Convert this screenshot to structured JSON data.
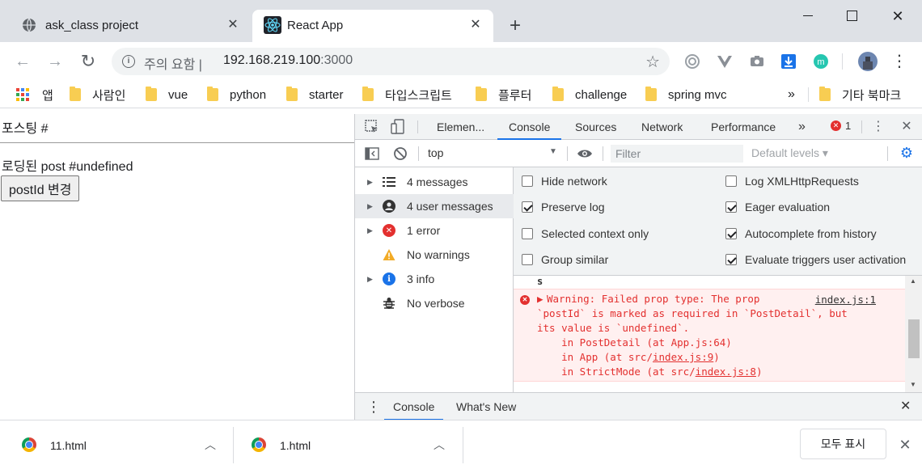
{
  "tabs": [
    {
      "title": "ask_class project",
      "close": "✕"
    },
    {
      "title": "React App",
      "close": "✕"
    }
  ],
  "new_tab": "+",
  "window": {
    "close": "✕"
  },
  "toolbar": {
    "back": "←",
    "forward": "→",
    "reload": "↻",
    "security_label": "주의 요함",
    "url_host": "192.168.219.100",
    "url_port": ":3000",
    "star": "☆",
    "menu": "⋮"
  },
  "bookmarks": {
    "apps": "앱",
    "items": [
      "사람인",
      "vue",
      "python",
      "starter",
      "타입스크립트",
      "플루터",
      "challenge",
      "spring mvc"
    ],
    "more": "»",
    "other": "기타 북마크",
    "apps_colors": [
      "#ea4335",
      "#4285f4",
      "#fbbc05",
      "#34a853",
      "#ea4335",
      "#4285f4",
      "#fbbc05",
      "#34a853",
      "#ea4335"
    ]
  },
  "page": {
    "heading": "포스팅 #",
    "loaded_text": "로딩된 post #undefined",
    "button_label": "postId 변경"
  },
  "devtools": {
    "tabs": [
      "Elemen...",
      "Console",
      "Sources",
      "Network",
      "Performance"
    ],
    "more_tabs": "»",
    "error_count": "1",
    "context": "top",
    "filter_placeholder": "Filter",
    "levels": "Default levels ▾",
    "sidebar": [
      {
        "label": "4 messages",
        "icon": "list-icon"
      },
      {
        "label": "4 user messages",
        "icon": "user-icon"
      },
      {
        "label": "1 error",
        "icon": "error-icon"
      },
      {
        "label": "No warnings",
        "icon": "warning-icon"
      },
      {
        "label": "3 info",
        "icon": "info-icon"
      },
      {
        "label": "No verbose",
        "icon": "bug-icon"
      }
    ],
    "settings": [
      {
        "label": "Hide network",
        "checked": false
      },
      {
        "label": "Log XMLHttpRequests",
        "checked": false
      },
      {
        "label": "Preserve log",
        "checked": true
      },
      {
        "label": "Eager evaluation",
        "checked": true
      },
      {
        "label": "Selected context only",
        "checked": false
      },
      {
        "label": "Autocomplete from history",
        "checked": true
      },
      {
        "label": "Group similar",
        "checked": false
      },
      {
        "label": "Evaluate triggers user activation",
        "checked": true
      }
    ],
    "log": {
      "prev_fragment": "s",
      "source": "index.js:1",
      "line1": "Warning: Failed prop type: The prop",
      "line2": "`postId` is marked as required in `PostDetail`, but",
      "line3": "its value is `undefined`.",
      "line4a": "    in PostDetail (at App.js:64)",
      "line5a": "    in App (at src/",
      "line5b": "index.js:9",
      "line5c": ")",
      "line6a": "    in StrictMode (at src/",
      "line6b": "index.js:8",
      "line6c": ")"
    },
    "drawer_tabs": [
      "Console",
      "What's New"
    ]
  },
  "downloads": {
    "items": [
      {
        "name": "11.html"
      },
      {
        "name": "1.html"
      }
    ],
    "show_all": "모두 표시"
  }
}
